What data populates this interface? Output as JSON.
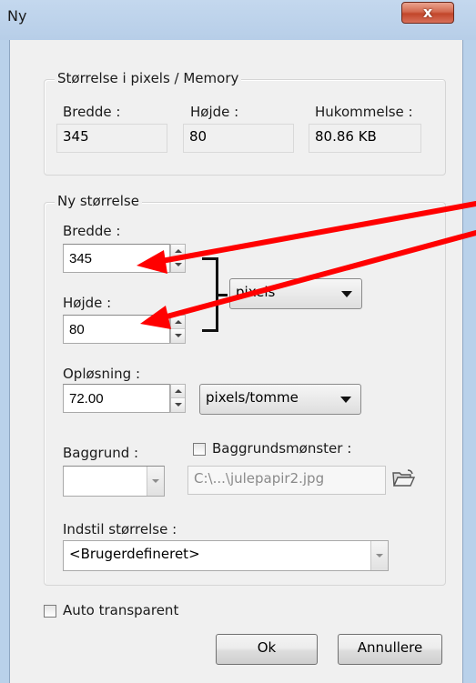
{
  "window": {
    "title": "Ny",
    "close_glyph": "x"
  },
  "memory_group": {
    "legend": "Størrelse i pixels / Memory",
    "width_label": "Bredde :",
    "height_label": "Højde :",
    "memory_label": "Hukommelse :",
    "width_value": "345",
    "height_value": "80",
    "memory_value": "80.86 KB"
  },
  "new_size_group": {
    "legend": "Ny størrelse",
    "width_label": "Bredde :",
    "width_value": "345",
    "height_label": "Højde :",
    "height_value": "80",
    "unit_selected": "pixels",
    "resolution_label": "Opløsning :",
    "resolution_value": "72.00",
    "resolution_unit_selected": "pixels/tomme",
    "background_label": "Baggrund :",
    "background_pattern_label": "Baggrundsmønster :",
    "background_pattern_file": "C:\\...\\julepapir2.jpg",
    "preset_label": "Indstil størrelse :",
    "preset_selected": "<Brugerdefineret>"
  },
  "auto_transparent_label": "Auto transparent",
  "buttons": {
    "ok": "Ok",
    "cancel": "Annullere"
  },
  "colors": {
    "annotation_arrow": "#ff0000",
    "close_button": "#c2462a",
    "window_frame": "#b9d1ea"
  }
}
